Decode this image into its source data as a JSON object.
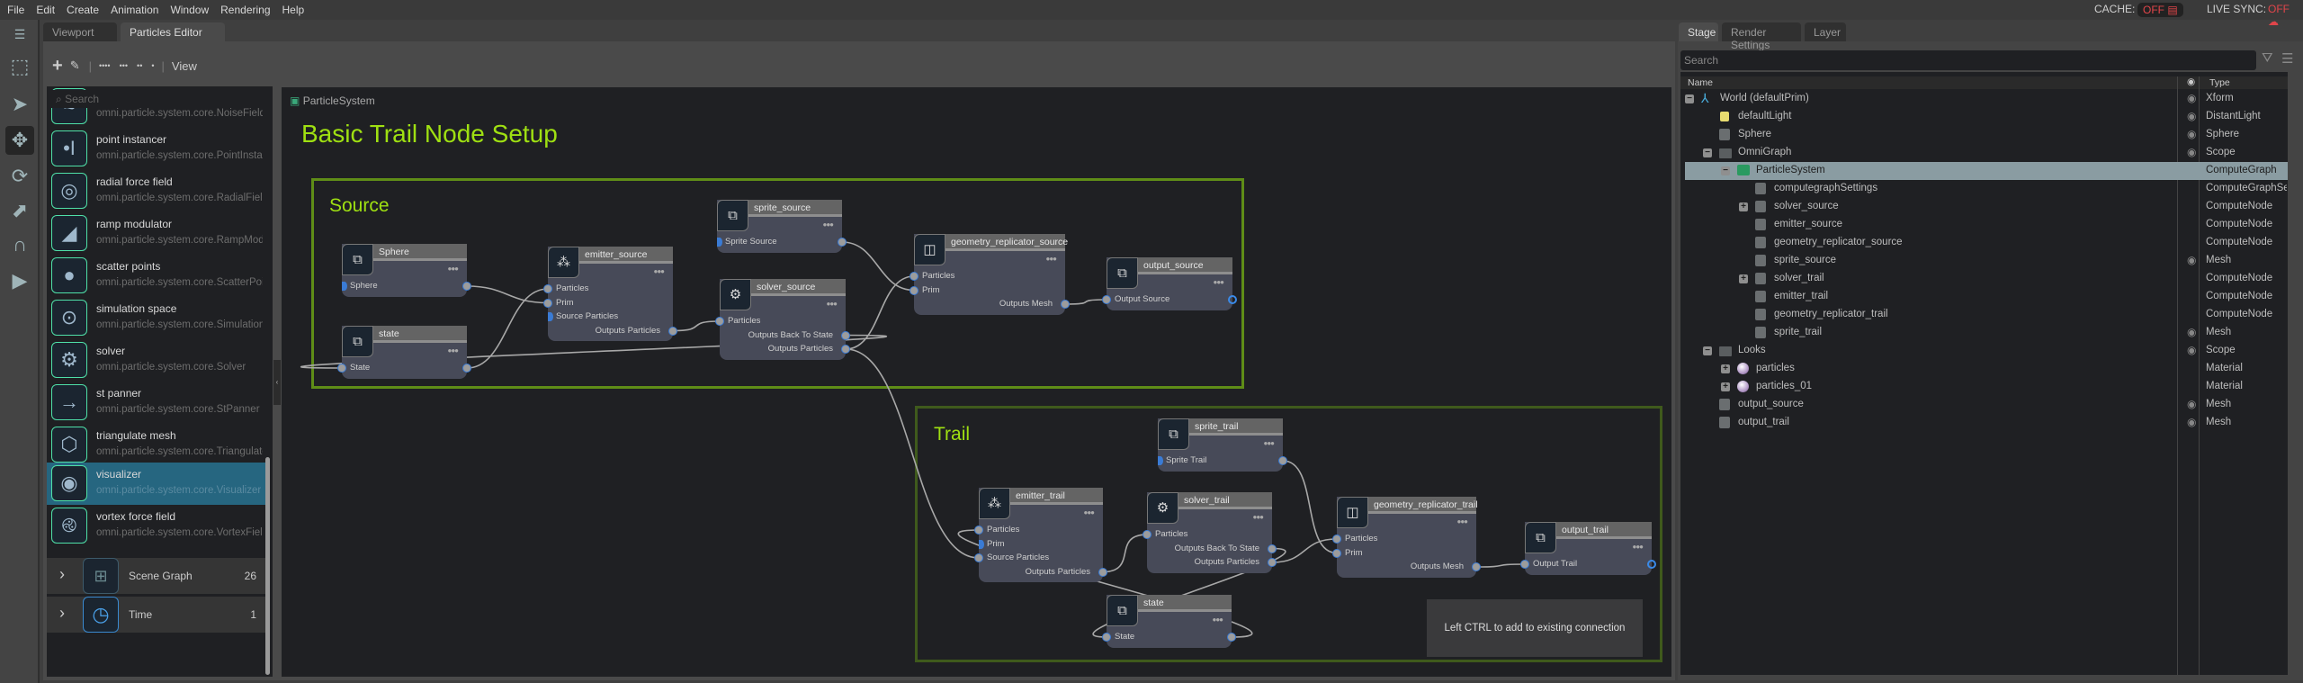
{
  "menu": [
    "File",
    "Edit",
    "Create",
    "Animation",
    "Window",
    "Rendering",
    "Help"
  ],
  "status": {
    "cache_label": "CACHE:",
    "cache_value": "OFF",
    "livesync_label": "LIVE SYNC:",
    "livesync_value": "OFF",
    "off_color": "#e0454a"
  },
  "tabs": {
    "viewport": "Viewport",
    "particles_editor": "Particles Editor"
  },
  "editor_toolbar": {
    "view_label": "View"
  },
  "library": {
    "search_placeholder": "Search",
    "items": [
      {
        "name": "",
        "sub": "omni.particle.system.core.NoiseField",
        "icon": "noise-icon",
        "glyph": "≈"
      },
      {
        "name": "point instancer",
        "sub": "omni.particle.system.core.PointInstancer",
        "icon": "point-instancer-icon",
        "glyph": "•I"
      },
      {
        "name": "radial force field",
        "sub": "omni.particle.system.core.RadialField",
        "icon": "radial-rings-icon",
        "glyph": "◎"
      },
      {
        "name": "ramp modulator",
        "sub": "omni.particle.system.core.RampModulator",
        "icon": "ramp-icon",
        "glyph": "◢"
      },
      {
        "name": "scatter points",
        "sub": "omni.particle.system.core.ScatterPoints",
        "icon": "scatter-sphere-icon",
        "glyph": "●"
      },
      {
        "name": "simulation space",
        "sub": "omni.particle.system.core.SimulationSpace",
        "icon": "orbit-icon",
        "glyph": "⊙"
      },
      {
        "name": "solver",
        "sub": "omni.particle.system.core.Solver",
        "icon": "head-gears-icon",
        "glyph": "⚙"
      },
      {
        "name": "st panner",
        "sub": "omni.particle.system.core.StPanner",
        "icon": "panner-arrow-icon",
        "glyph": "→"
      },
      {
        "name": "triangulate mesh",
        "sub": "omni.particle.system.core.TriangulateMesh",
        "icon": "wire-cube-icon",
        "glyph": "⬡"
      },
      {
        "name": "visualizer",
        "sub": "omni.particle.system.core.Visualizer",
        "icon": "eye-icon",
        "glyph": "◉",
        "selected": true
      },
      {
        "name": "vortex force field",
        "sub": "omni.particle.system.core.VortexField",
        "icon": "vortex-icon",
        "glyph": "࿋"
      }
    ],
    "groups": [
      {
        "label": "Scene Graph",
        "count": "26",
        "icon": "hierarchy-icon"
      },
      {
        "label": "Time",
        "count": "1",
        "icon": "clock-icon"
      }
    ]
  },
  "graph": {
    "breadcrumb": "ParticleSystem",
    "title": "Basic Trail Node Setup",
    "title_color": "#9fe012",
    "groups": [
      {
        "id": "source",
        "label": "Source"
      },
      {
        "id": "trail",
        "label": "Trail"
      }
    ],
    "nodes": [
      {
        "id": "sphere",
        "title": "Sphere",
        "icon": "prim-icon",
        "ports": [
          {
            "label": "Sphere",
            "in": true,
            "out": true,
            "in_open": true
          }
        ]
      },
      {
        "id": "state_source",
        "title": "state",
        "icon": "prim-icon",
        "ports": [
          {
            "label": "State",
            "in": true,
            "out": true
          }
        ]
      },
      {
        "id": "emitter_source",
        "title": "emitter_source",
        "icon": "emitter-sparkle-icon",
        "ports": [
          {
            "label": "Particles",
            "in": true
          },
          {
            "label": "Prim",
            "in": true
          },
          {
            "label": "Source Particles",
            "in": true,
            "in_open": true
          },
          {
            "label": "Outputs Particles",
            "out": true
          }
        ]
      },
      {
        "id": "sprite_source",
        "title": "sprite_source",
        "icon": "prim-icon",
        "ports": [
          {
            "label": "Sprite Source",
            "in": true,
            "out": true,
            "in_open": true
          }
        ]
      },
      {
        "id": "solver_source",
        "title": "solver_source",
        "icon": "head-gears-icon",
        "ports": [
          {
            "label": "Particles",
            "in": true
          },
          {
            "label": "Outputs Back To State",
            "out": true
          },
          {
            "label": "Outputs Particles",
            "out": true
          }
        ]
      },
      {
        "id": "geometry_replicator_source",
        "title": "geometry_replicator_source",
        "icon": "geometry-replicator-icon",
        "ports": [
          {
            "label": "Particles",
            "in": true
          },
          {
            "label": "Prim",
            "in": true
          },
          {
            "label": "Outputs Mesh",
            "out": true
          }
        ]
      },
      {
        "id": "output_source",
        "title": "output_source",
        "icon": "prim-icon",
        "ports": [
          {
            "label": "Output Source",
            "in": true,
            "out": true,
            "out_ring": true
          }
        ]
      },
      {
        "id": "sprite_trail",
        "title": "sprite_trail",
        "icon": "prim-icon",
        "ports": [
          {
            "label": "Sprite Trail",
            "in": true,
            "out": true,
            "in_open": true
          }
        ]
      },
      {
        "id": "emitter_trail",
        "title": "emitter_trail",
        "icon": "emitter-sparkle-icon",
        "ports": [
          {
            "label": "Particles",
            "in": true
          },
          {
            "label": "Prim",
            "in": true,
            "in_open": true
          },
          {
            "label": "Source Particles",
            "in": true
          },
          {
            "label": "Outputs Particles",
            "out": true
          }
        ]
      },
      {
        "id": "solver_trail",
        "title": "solver_trail",
        "icon": "head-gears-icon",
        "ports": [
          {
            "label": "Particles",
            "in": true
          },
          {
            "label": "Outputs Back To State",
            "out": true
          },
          {
            "label": "Outputs Particles",
            "out": true
          }
        ]
      },
      {
        "id": "geometry_replicator_trail",
        "title": "geometry_replicator_trail",
        "icon": "geometry-replicator-icon",
        "ports": [
          {
            "label": "Particles",
            "in": true
          },
          {
            "label": "Prim",
            "in": true
          },
          {
            "label": "Outputs Mesh",
            "out": true
          }
        ]
      },
      {
        "id": "output_trail",
        "title": "output_trail",
        "icon": "prim-icon",
        "ports": [
          {
            "label": "Output Trail",
            "in": true,
            "out": true,
            "out_ring": true
          }
        ]
      },
      {
        "id": "state_trail",
        "title": "state",
        "icon": "prim-icon",
        "ports": [
          {
            "label": "State",
            "in": true,
            "out": true
          }
        ]
      }
    ],
    "connections": [
      [
        "sphere",
        0,
        "emitter_source",
        1
      ],
      [
        "state_source",
        0,
        "emitter_source",
        0
      ],
      [
        "emitter_source",
        3,
        "solver_source",
        0
      ],
      [
        "solver_source",
        1,
        "state_source",
        0
      ],
      [
        "sprite_source",
        0,
        "geometry_replicator_source",
        1
      ],
      [
        "solver_source",
        2,
        "geometry_replicator_source",
        0
      ],
      [
        "geometry_replicator_source",
        2,
        "output_source",
        0
      ],
      [
        "solver_source",
        2,
        "emitter_trail",
        2
      ],
      [
        "emitter_trail",
        3,
        "solver_trail",
        0
      ],
      [
        "solver_trail",
        1,
        "state_trail",
        0
      ],
      [
        "state_trail",
        0,
        "emitter_trail",
        0
      ],
      [
        "sprite_trail",
        0,
        "geometry_replicator_trail",
        1
      ],
      [
        "solver_trail",
        2,
        "geometry_replicator_trail",
        0
      ],
      [
        "geometry_replicator_trail",
        2,
        "output_trail",
        0
      ]
    ],
    "tooltip": "Left CTRL to add to existing connection"
  },
  "stage": {
    "tabs": [
      "Stage",
      "Render Settings",
      "Layer"
    ],
    "search_placeholder": "Search",
    "col_name": "Name",
    "col_type": "Type",
    "rows": [
      {
        "name": "World (defaultPrim)",
        "type": "Xform",
        "level": 0,
        "exp": "−",
        "icon": "xform-axes-icon",
        "eye": true
      },
      {
        "name": "defaultLight",
        "type": "DistantLight",
        "level": 1,
        "icon": "light-icon",
        "eye": true
      },
      {
        "name": "Sphere",
        "type": "Sphere",
        "level": 1,
        "icon": "mesh-cube-icon",
        "eye": true
      },
      {
        "name": "OmniGraph",
        "type": "Scope",
        "level": 1,
        "exp": "−",
        "icon": "folder-icon",
        "eye": true
      },
      {
        "name": "ParticleSystem",
        "type": "ComputeGraph",
        "level": 2,
        "exp": "−",
        "icon": "compute-graph-icon",
        "selected": true
      },
      {
        "name": "computegraphSettings",
        "type": "ComputeGraphSettings",
        "level": 3,
        "icon": "mesh-cube-icon"
      },
      {
        "name": "solver_source",
        "type": "ComputeNode",
        "level": 3,
        "exp": "+",
        "icon": "mesh-cube-icon"
      },
      {
        "name": "emitter_source",
        "type": "ComputeNode",
        "level": 3,
        "icon": "mesh-cube-icon"
      },
      {
        "name": "geometry_replicator_source",
        "type": "ComputeNode",
        "level": 3,
        "icon": "mesh-cube-icon"
      },
      {
        "name": "sprite_source",
        "type": "Mesh",
        "level": 3,
        "icon": "mesh-cube-icon",
        "eye": true
      },
      {
        "name": "solver_trail",
        "type": "ComputeNode",
        "level": 3,
        "exp": "+",
        "icon": "mesh-cube-icon"
      },
      {
        "name": "emitter_trail",
        "type": "ComputeNode",
        "level": 3,
        "icon": "mesh-cube-icon"
      },
      {
        "name": "geometry_replicator_trail",
        "type": "ComputeNode",
        "level": 3,
        "icon": "mesh-cube-icon"
      },
      {
        "name": "sprite_trail",
        "type": "Mesh",
        "level": 3,
        "icon": "mesh-cube-icon",
        "eye": true
      },
      {
        "name": "Looks",
        "type": "Scope",
        "level": 1,
        "exp": "−",
        "icon": "folder-icon",
        "eye": true
      },
      {
        "name": "particles",
        "type": "Material",
        "level": 2,
        "exp": "+",
        "icon": "material-sphere-icon"
      },
      {
        "name": "particles_01",
        "type": "Material",
        "level": 2,
        "exp": "+",
        "icon": "material-sphere-icon"
      },
      {
        "name": "output_source",
        "type": "Mesh",
        "level": 1,
        "icon": "mesh-cube-icon",
        "eye": true
      },
      {
        "name": "output_trail",
        "type": "Mesh",
        "level": 1,
        "icon": "mesh-cube-icon",
        "eye": true
      }
    ]
  }
}
